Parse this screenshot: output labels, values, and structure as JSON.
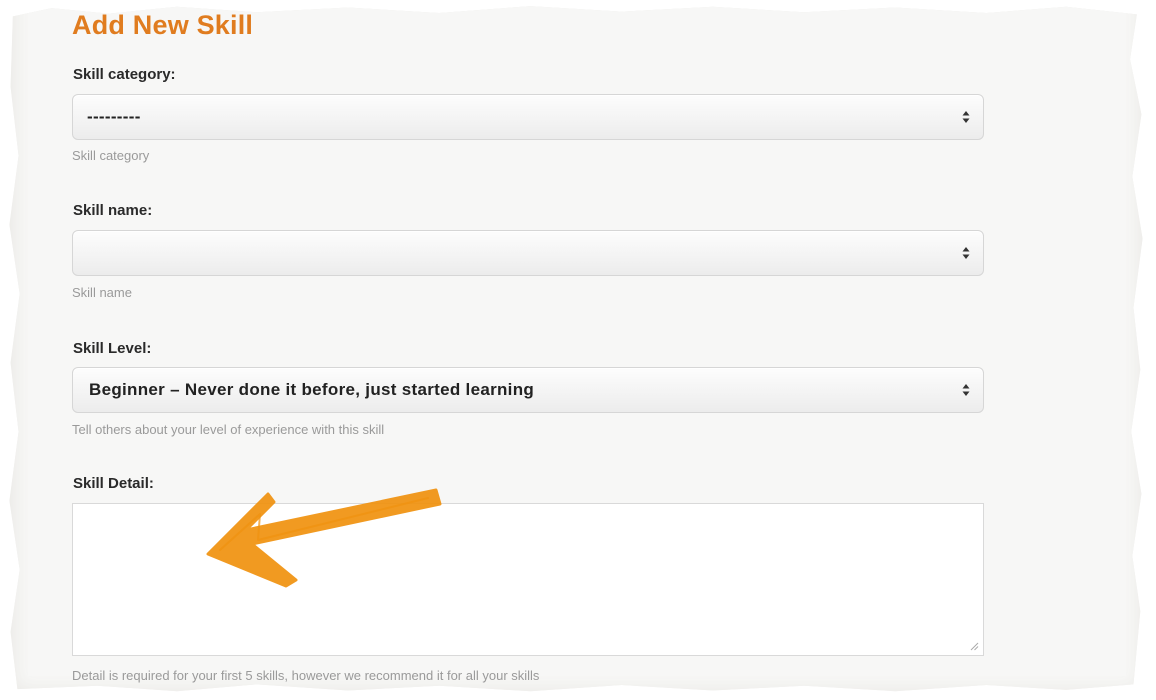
{
  "form": {
    "title": "Add New Skill",
    "category": {
      "label": "Skill category:",
      "selected": "---------",
      "help": "Skill category"
    },
    "name": {
      "label": "Skill name:",
      "selected": "",
      "help": "Skill name"
    },
    "level": {
      "label": "Skill Level:",
      "selected": "Beginner – Never done it before, just started learning",
      "help": "Tell others about your level of experience with this skill"
    },
    "detail": {
      "label": "Skill Detail:",
      "value": "",
      "help": "Detail is required for your first 5 skills, however we recommend it for all your skills"
    }
  },
  "colors": {
    "title": "#e07c1f",
    "annotation_arrow": "#f0920f"
  },
  "icons": {
    "select_arrows": "up-down-arrows-icon",
    "resize_grip": "resize-grip-icon",
    "annotation": "orange-arrow-annotation"
  }
}
